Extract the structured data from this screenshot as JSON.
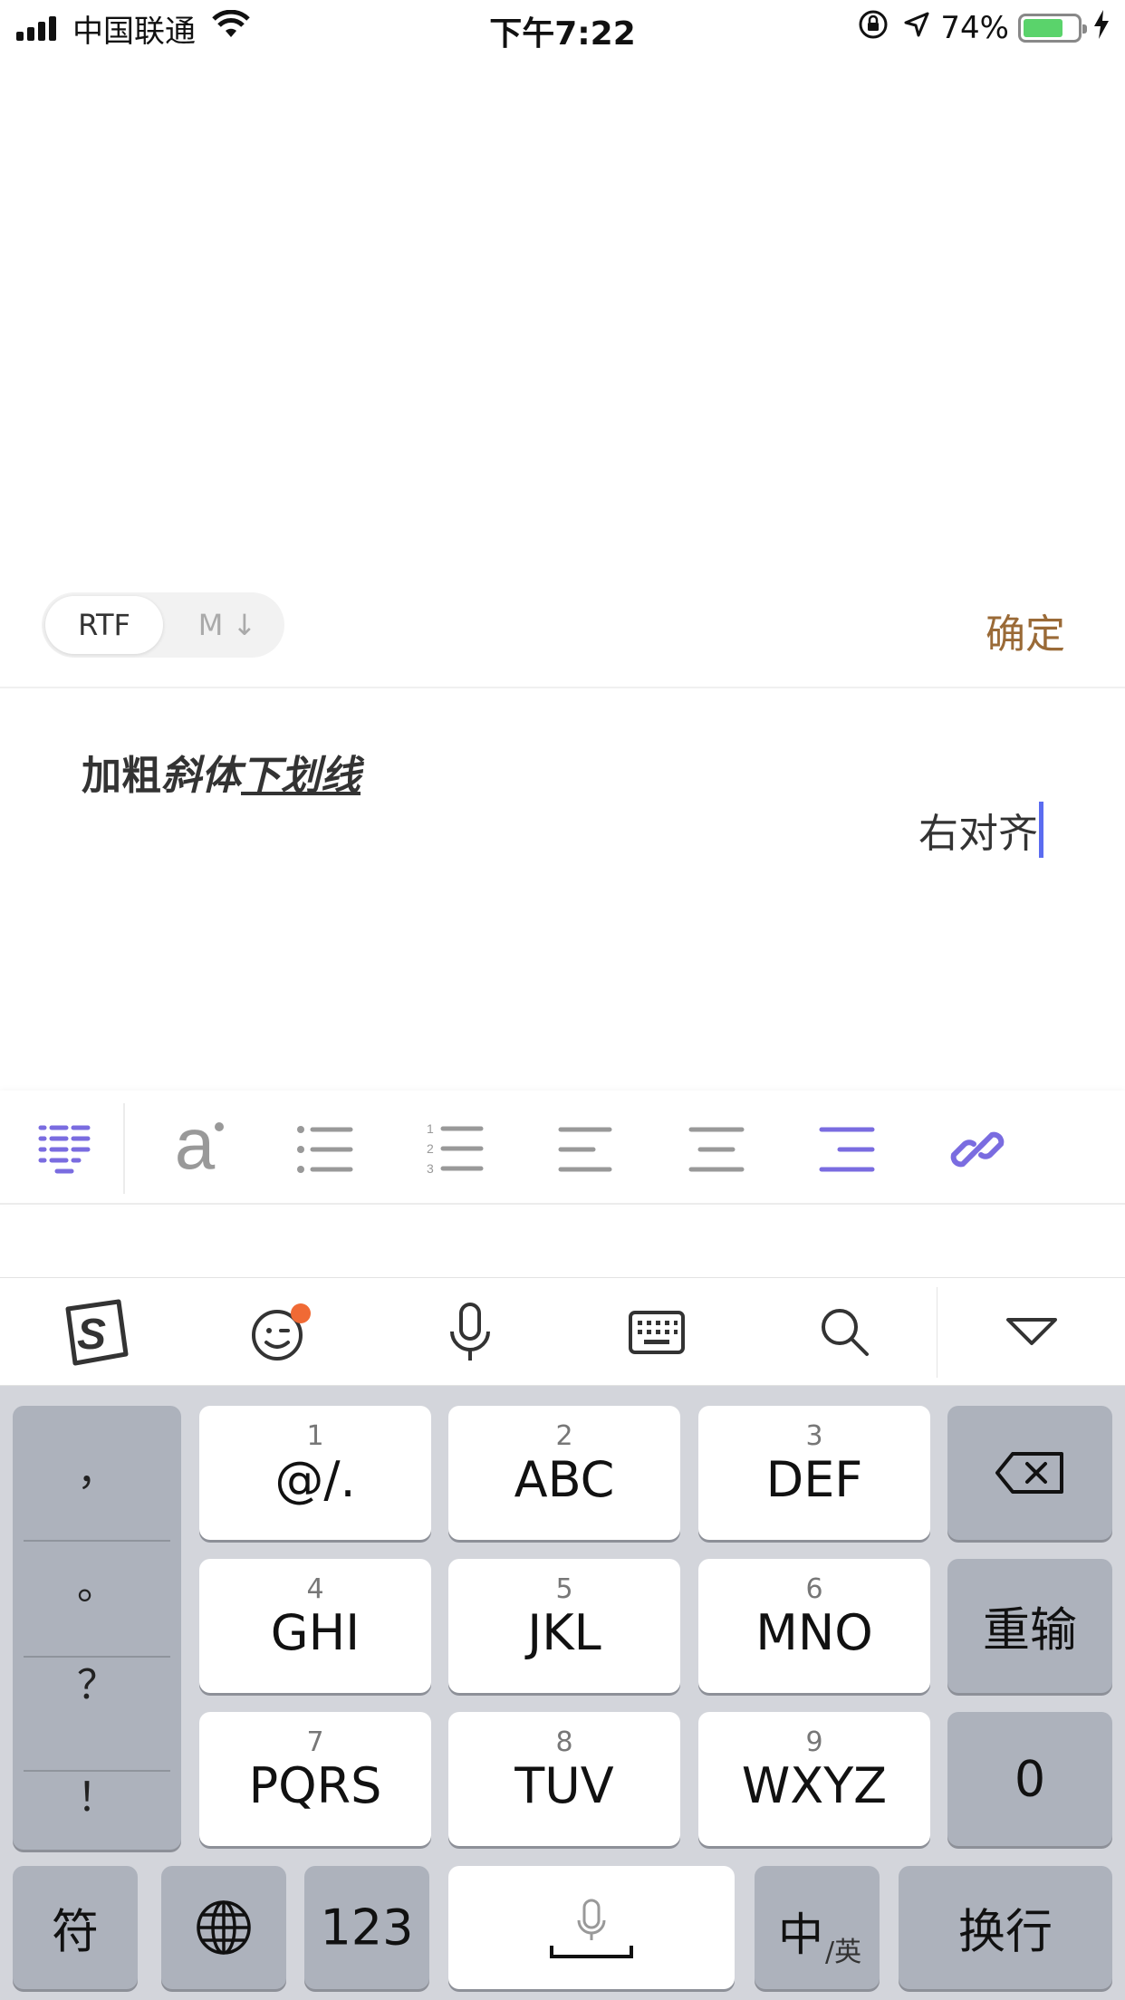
{
  "status_bar": {
    "carrier": "中国联通",
    "time": "下午7:22",
    "battery_percent": "74%",
    "battery_level": 0.74,
    "battery_color": "#5ad36b"
  },
  "editor": {
    "mode_rtf": "RTF",
    "mode_md": "M ↓",
    "confirm": "确定",
    "confirm_color": "#9a6a37",
    "content": {
      "bold": "加粗",
      "italic": "斜体",
      "underline": "下划线",
      "right_aligned": "右对齐"
    },
    "caret_color": "#5b6cf0"
  },
  "format_toolbar": {
    "accent_color": "#7a6ce0",
    "font_glyph": "a",
    "items": [
      "paragraph-format-icon",
      "font-style-icon",
      "bullet-list-icon",
      "numbered-list-icon",
      "align-left-icon",
      "align-center-icon",
      "align-right-icon",
      "link-icon"
    ],
    "active": [
      "paragraph-format-icon",
      "align-right-icon",
      "link-icon"
    ]
  },
  "ime_toolbar": {
    "items": [
      "sogou-logo-icon",
      "emoji-icon",
      "microphone-icon",
      "keyboard-icon",
      "search-icon",
      "collapse-icon"
    ],
    "badge_color": "#f06a35"
  },
  "keyboard": {
    "punctuation": [
      "，",
      "。",
      "？",
      "！"
    ],
    "keys": [
      {
        "num": "1",
        "label": "@/."
      },
      {
        "num": "2",
        "label": "ABC"
      },
      {
        "num": "3",
        "label": "DEF"
      },
      {
        "num": "4",
        "label": "GHI"
      },
      {
        "num": "5",
        "label": "JKL"
      },
      {
        "num": "6",
        "label": "MNO"
      },
      {
        "num": "7",
        "label": "PQRS"
      },
      {
        "num": "8",
        "label": "TUV"
      },
      {
        "num": "9",
        "label": "WXYZ"
      }
    ],
    "reenter": "重输",
    "zero": "0",
    "symbols": "符",
    "numbers": "123",
    "lang_main": "中",
    "lang_sub": "/英",
    "enter": "换行"
  }
}
